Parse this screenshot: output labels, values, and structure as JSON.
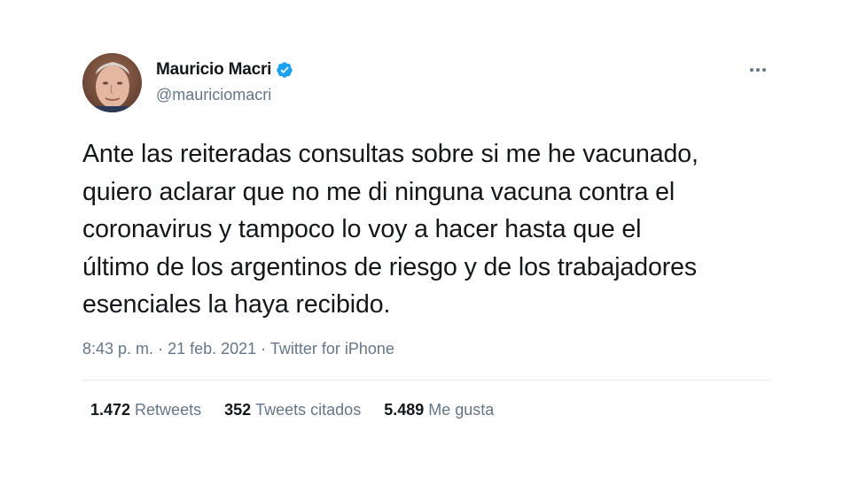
{
  "tweet": {
    "author": {
      "name": "Mauricio Macri",
      "handle": "@mauriciomacri",
      "verified": true,
      "avatar_icon": "profile-photo"
    },
    "more_icon": "more-horizontal-icon",
    "text": "Ante las reiteradas consultas sobre si me he vacunado,\nquiero aclarar que no me di ninguna vacuna contra el\ncoronavirus y tampoco lo voy a hacer hasta que el\núltimo de los argentinos de riesgo y de los trabajadores\nesenciales la haya recibido.",
    "time": "8:43 p. m.",
    "separator": "·",
    "date": "21 feb. 2021",
    "source": "Twitter for iPhone",
    "stats": {
      "retweets_count": "1.472",
      "retweets_label": "Retweets",
      "quotes_count": "352",
      "quotes_label": "Tweets citados",
      "likes_count": "5.489",
      "likes_label": "Me gusta"
    }
  },
  "colors": {
    "text": "#14171a",
    "secondary": "#657786",
    "verified": "#1da1f2",
    "divider": "#e6ecf0"
  }
}
